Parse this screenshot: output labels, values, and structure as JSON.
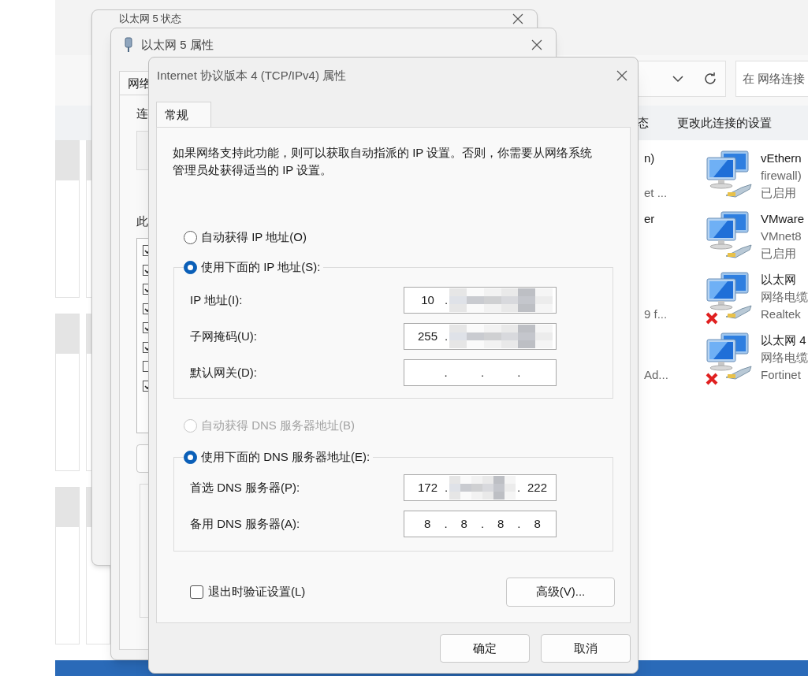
{
  "explorer": {
    "search_placeholder": "在 网络连接",
    "commands": [
      {
        "label": "态"
      },
      {
        "label": "更改此连接的设置"
      }
    ],
    "partial_items": [
      {
        "line_1": "n)",
        "line_3": "et ..."
      },
      {
        "line_1": "er"
      },
      {
        "line_3": "9 f..."
      },
      {
        "line_3": "Ad..."
      }
    ],
    "connections": [
      {
        "name": "vEthern",
        "lines": [
          "firewall)",
          "已启用"
        ],
        "disconnected": false
      },
      {
        "name": "VMware",
        "lines": [
          "VMnet8",
          "已启用"
        ],
        "disconnected": false
      },
      {
        "name": "以太网",
        "lines": [
          "网络电缆",
          "Realtek"
        ],
        "disconnected": true
      },
      {
        "name": "以太网 4",
        "lines": [
          "网络电缆",
          "Fortinet"
        ],
        "disconnected": true
      }
    ]
  },
  "status_window": {
    "title": "以太网 5 状态"
  },
  "properties_window": {
    "title": "以太网 5 属性",
    "tabs": [
      {
        "label": "网络",
        "selected": true
      }
    ],
    "label_1": "连",
    "label_2": "此",
    "components": [
      {
        "checked": true
      },
      {
        "checked": true
      },
      {
        "checked": true
      },
      {
        "checked": true
      },
      {
        "checked": true
      },
      {
        "checked": true
      },
      {
        "checked": false
      },
      {
        "checked": true
      }
    ]
  },
  "ipv4_dialog": {
    "title": "Internet 协议版本 4 (TCP/IPv4) 属性",
    "tabs": [
      {
        "label": "常规",
        "selected": true
      }
    ],
    "description": "如果网络支持此功能，则可以获取自动指派的 IP 设置。否则，你需要从网络系统管理员处获得适当的 IP 设置。",
    "ip_options": [
      {
        "label": "自动获得 IP 地址(O)",
        "selected": false,
        "disabled": false
      },
      {
        "label": "使用下面的 IP 地址(S):",
        "selected": true,
        "disabled": false
      }
    ],
    "ip_fields": [
      {
        "label": "IP 地址(I):",
        "segments": [
          {
            "kind": "octet",
            "text": "10"
          },
          {
            "kind": "dot",
            "text": "."
          },
          {
            "kind": "mosaic"
          }
        ]
      },
      {
        "label": "子网掩码(U):",
        "segments": [
          {
            "kind": "octet",
            "text": "255"
          },
          {
            "kind": "dot",
            "text": "."
          },
          {
            "kind": "mosaic"
          }
        ]
      },
      {
        "label": "默认网关(D):",
        "segments": [
          {
            "kind": "blank"
          },
          {
            "kind": "dot",
            "text": "."
          },
          {
            "kind": "blank"
          },
          {
            "kind": "dot",
            "text": "."
          },
          {
            "kind": "blank"
          },
          {
            "kind": "dot",
            "text": "."
          },
          {
            "kind": "blank"
          }
        ]
      }
    ],
    "dns_options": [
      {
        "label": "自动获得 DNS 服务器地址(B)",
        "selected": false,
        "disabled": true
      },
      {
        "label": "使用下面的 DNS 服务器地址(E):",
        "selected": true,
        "disabled": false
      }
    ],
    "dns_fields": [
      {
        "label": "首选 DNS 服务器(P):",
        "segments": [
          {
            "kind": "octet",
            "text": "172"
          },
          {
            "kind": "dot",
            "text": "."
          },
          {
            "kind": "mosaic"
          },
          {
            "kind": "dot",
            "text": "."
          },
          {
            "kind": "octet",
            "text": "222"
          }
        ]
      },
      {
        "label": "备用 DNS 服务器(A):",
        "segments": [
          {
            "kind": "octet",
            "text": "8"
          },
          {
            "kind": "dot",
            "text": "."
          },
          {
            "kind": "octet",
            "text": "8"
          },
          {
            "kind": "dot",
            "text": "."
          },
          {
            "kind": "octet",
            "text": "8"
          },
          {
            "kind": "dot",
            "text": "."
          },
          {
            "kind": "octet",
            "text": "8"
          }
        ]
      }
    ],
    "validate_on_exit": {
      "label": "退出时验证设置(L)",
      "checked": false
    },
    "advanced_button": "高级(V)...",
    "buttons": [
      "确定",
      "取消"
    ]
  }
}
